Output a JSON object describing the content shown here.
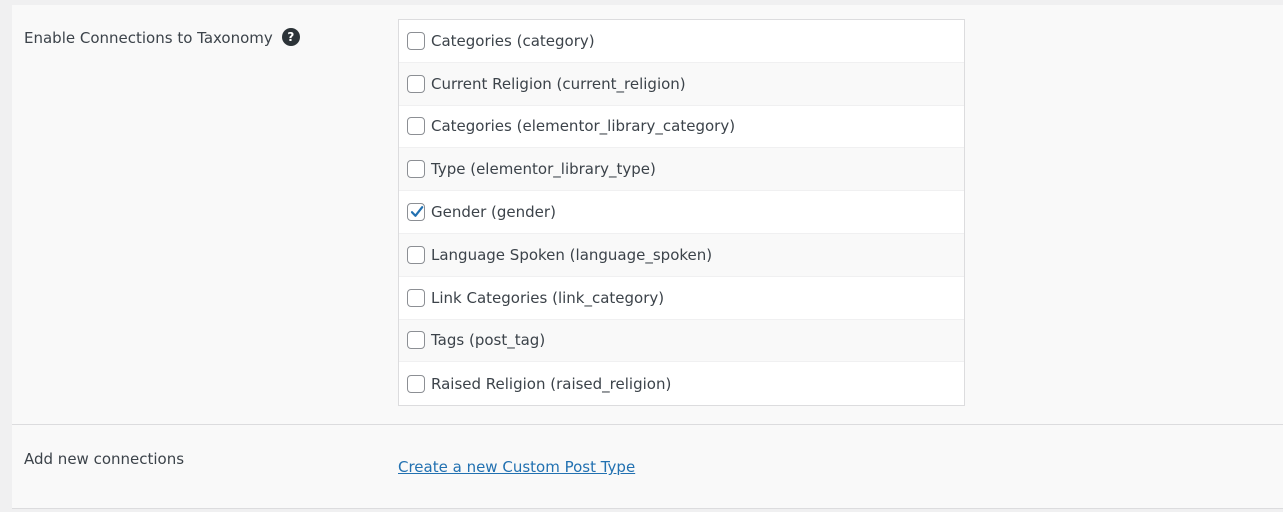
{
  "taxonomy_section": {
    "label": "Enable Connections to Taxonomy",
    "help_icon": "question-circle-icon",
    "items": [
      {
        "label": "Categories (category)",
        "checked": false
      },
      {
        "label": "Current Religion (current_religion)",
        "checked": false
      },
      {
        "label": "Categories (elementor_library_category)",
        "checked": false
      },
      {
        "label": "Type (elementor_library_type)",
        "checked": false
      },
      {
        "label": "Gender (gender)",
        "checked": true
      },
      {
        "label": "Language Spoken (language_spoken)",
        "checked": false
      },
      {
        "label": "Link Categories (link_category)",
        "checked": false
      },
      {
        "label": "Tags (post_tag)",
        "checked": false
      },
      {
        "label": "Raised Religion (raised_religion)",
        "checked": false
      }
    ]
  },
  "connections_section": {
    "label": "Add new connections",
    "link_label": "Create a new Custom Post Type"
  },
  "colors": {
    "accent": "#2271b1",
    "checkmark": "#2271b1",
    "text": "#3c434a"
  }
}
